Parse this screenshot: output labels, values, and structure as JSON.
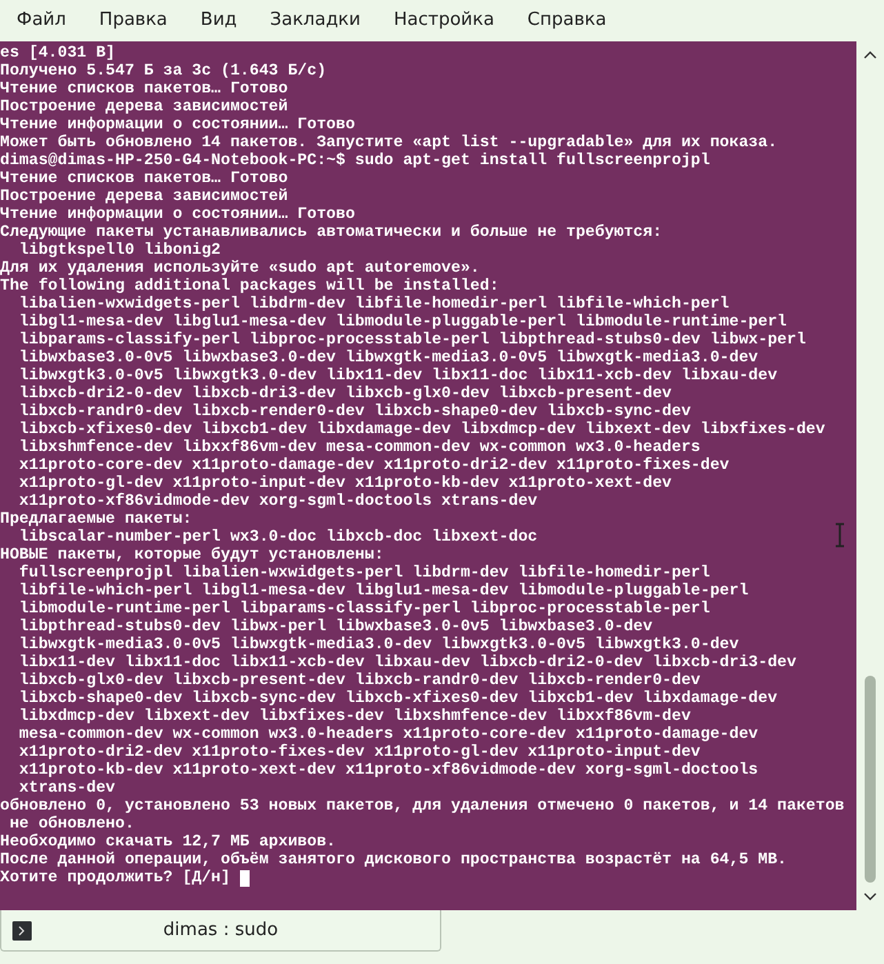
{
  "menu": [
    "Файл",
    "Правка",
    "Вид",
    "Закладки",
    "Настройка",
    "Справка"
  ],
  "terminal": {
    "lines": [
      "es [4.031 B]",
      "Получено 5.547 Б за 3с (1.643 Б/с)",
      "Чтение списков пакетов… Готово",
      "Построение дерева зависимостей",
      "Чтение информации о состоянии… Готово",
      "Может быть обновлено 14 пакетов. Запустите «apt list --upgradable» для их показа.",
      "dimas@dimas-HP-250-G4-Notebook-PC:~$ sudo apt-get install fullscreenprojpl",
      "Чтение списков пакетов… Готово",
      "Построение дерева зависимостей",
      "Чтение информации о состоянии… Готово",
      "Следующие пакеты устанавливались автоматически и больше не требуются:",
      "  libgtkspell0 libonig2",
      "Для их удаления используйте «sudo apt autoremove».",
      "The following additional packages will be installed:",
      "  libalien-wxwidgets-perl libdrm-dev libfile-homedir-perl libfile-which-perl",
      "  libgl1-mesa-dev libglu1-mesa-dev libmodule-pluggable-perl libmodule-runtime-perl",
      "  libparams-classify-perl libproc-processtable-perl libpthread-stubs0-dev libwx-perl",
      "  libwxbase3.0-0v5 libwxbase3.0-dev libwxgtk-media3.0-0v5 libwxgtk-media3.0-dev",
      "  libwxgtk3.0-0v5 libwxgtk3.0-dev libx11-dev libx11-doc libx11-xcb-dev libxau-dev",
      "  libxcb-dri2-0-dev libxcb-dri3-dev libxcb-glx0-dev libxcb-present-dev",
      "  libxcb-randr0-dev libxcb-render0-dev libxcb-shape0-dev libxcb-sync-dev",
      "  libxcb-xfixes0-dev libxcb1-dev libxdamage-dev libxdmcp-dev libxext-dev libxfixes-dev",
      "  libxshmfence-dev libxxf86vm-dev mesa-common-dev wx-common wx3.0-headers",
      "  x11proto-core-dev x11proto-damage-dev x11proto-dri2-dev x11proto-fixes-dev",
      "  x11proto-gl-dev x11proto-input-dev x11proto-kb-dev x11proto-xext-dev",
      "  x11proto-xf86vidmode-dev xorg-sgml-doctools xtrans-dev",
      "Предлагаемые пакеты:",
      "  libscalar-number-perl wx3.0-doc libxcb-doc libxext-doc",
      "НОВЫЕ пакеты, которые будут установлены:",
      "  fullscreenprojpl libalien-wxwidgets-perl libdrm-dev libfile-homedir-perl",
      "  libfile-which-perl libgl1-mesa-dev libglu1-mesa-dev libmodule-pluggable-perl",
      "  libmodule-runtime-perl libparams-classify-perl libproc-processtable-perl",
      "  libpthread-stubs0-dev libwx-perl libwxbase3.0-0v5 libwxbase3.0-dev",
      "  libwxgtk-media3.0-0v5 libwxgtk-media3.0-dev libwxgtk3.0-0v5 libwxgtk3.0-dev",
      "  libx11-dev libx11-doc libx11-xcb-dev libxau-dev libxcb-dri2-0-dev libxcb-dri3-dev",
      "  libxcb-glx0-dev libxcb-present-dev libxcb-randr0-dev libxcb-render0-dev",
      "  libxcb-shape0-dev libxcb-sync-dev libxcb-xfixes0-dev libxcb1-dev libxdamage-dev",
      "  libxdmcp-dev libxext-dev libxfixes-dev libxshmfence-dev libxxf86vm-dev",
      "  mesa-common-dev wx-common wx3.0-headers x11proto-core-dev x11proto-damage-dev",
      "  x11proto-dri2-dev x11proto-fixes-dev x11proto-gl-dev x11proto-input-dev",
      "  x11proto-kb-dev x11proto-xext-dev x11proto-xf86vidmode-dev xorg-sgml-doctools",
      "  xtrans-dev",
      "обновлено 0, установлено 53 новых пакетов, для удаления отмечено 0 пакетов, и 14 пакетов",
      " не обновлено.",
      "Необходимо скачать 12,7 МБ архивов.",
      "После данной операции, объём занятого дискового пространства возрастёт на 64,5 MB.",
      "Хотите продолжить? [Д/н]"
    ],
    "cursor_visible": true
  },
  "tabs": [
    {
      "label": "dimas : sudo",
      "selected": true
    }
  ]
}
